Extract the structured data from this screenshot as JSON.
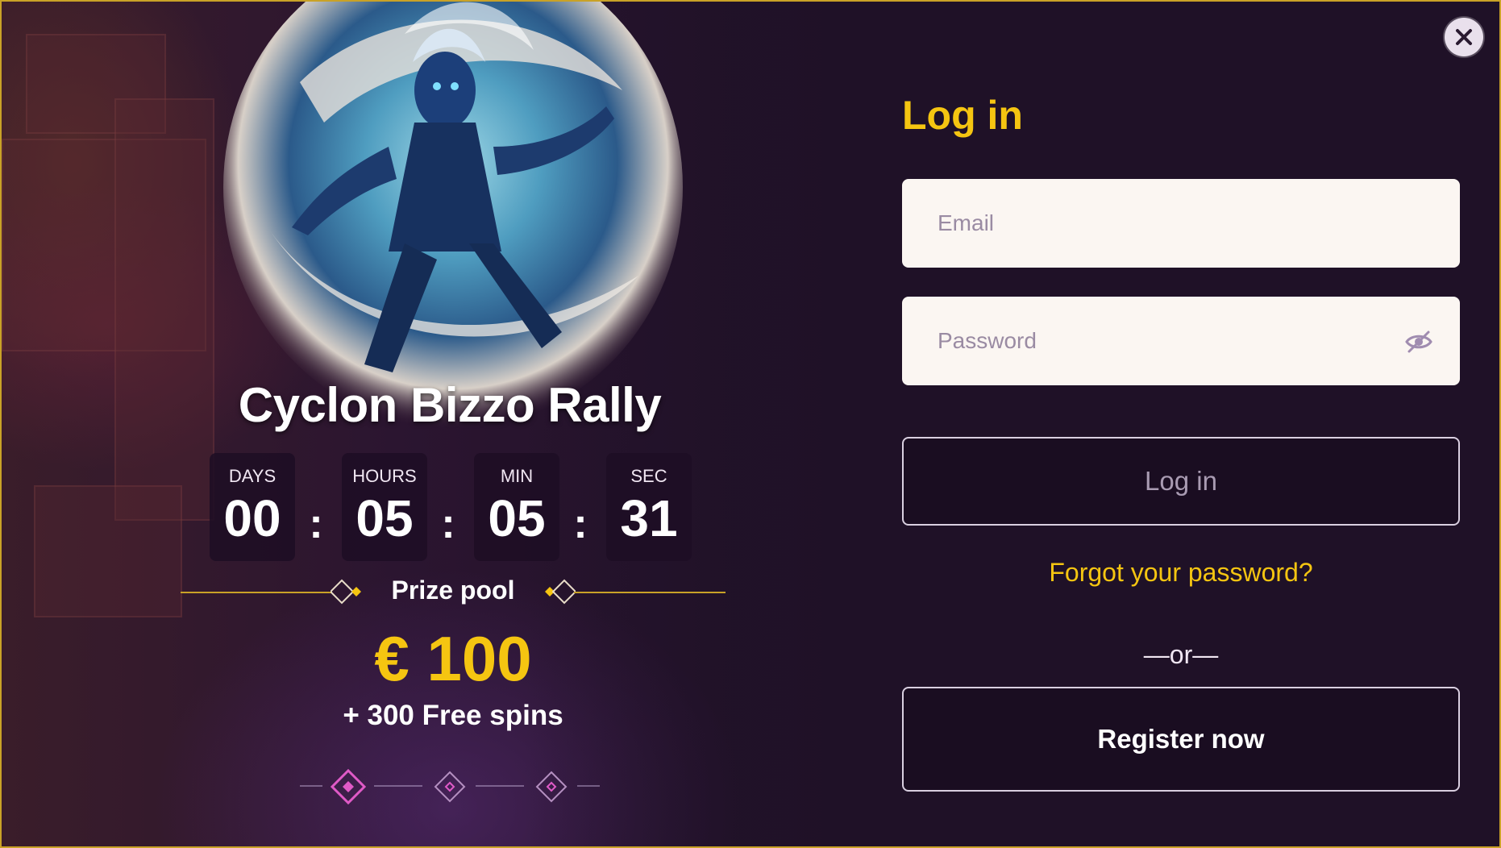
{
  "promo": {
    "event_title": "Cyclon Bizzo Rally",
    "countdown": [
      {
        "label": "DAYS",
        "value": "00"
      },
      {
        "label": "HOURS",
        "value": "05"
      },
      {
        "label": "MIN",
        "value": "05"
      },
      {
        "label": "SEC",
        "value": "31"
      }
    ],
    "separator": ":",
    "prize_label": "Prize pool",
    "prize_amount": "€ 100",
    "prize_extra": "+ 300 Free spins",
    "pager_count": 3,
    "pager_active": 1
  },
  "login": {
    "title": "Log in",
    "email_placeholder": "Email",
    "password_placeholder": "Password",
    "login_button": "Log in",
    "forgot_password": "Forgot your password?",
    "or_text": "—or—",
    "register_button": "Register now"
  },
  "icons": {
    "close": "close-icon",
    "eye_toggle": "eye-slash-icon",
    "hero": "storm-warrior-illustration",
    "ornament": "diamond-ornament-icon"
  },
  "colors": {
    "accent_gold": "#f5c511",
    "border_gold": "#c9a227",
    "background": "#1f1127",
    "pager_pink": "#e05ac7",
    "field_bg": "#fbf6f2"
  }
}
